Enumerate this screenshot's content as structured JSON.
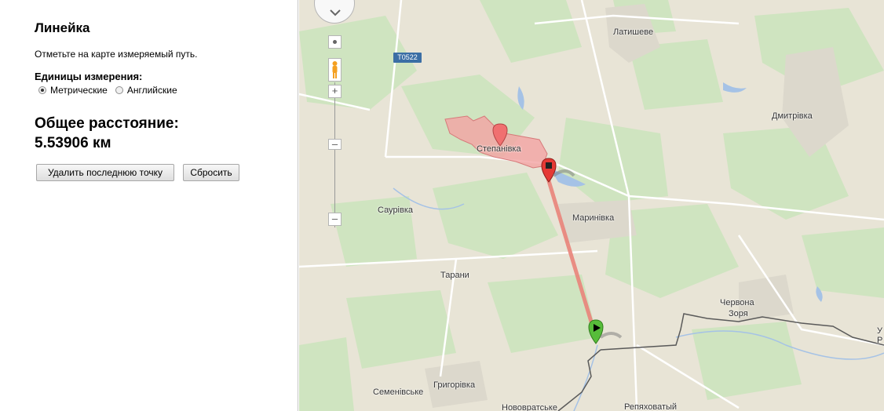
{
  "sidebar": {
    "title": "Линейка",
    "hint": "Отметьте на карте измеряемый путь.",
    "units_label": "Единицы измерения:",
    "units_options": [
      {
        "label": "Метрические",
        "selected": true
      },
      {
        "label": "Английские",
        "selected": false
      }
    ],
    "total_label": "Общее расстояние:",
    "total_value": "5.53906 км",
    "buttons": {
      "undo_label": "Удалить последнюю точку",
      "reset_label": "Сбросить"
    }
  },
  "map": {
    "road_shield": "T0522",
    "places": [
      "Латишеве",
      "Дмитрівка",
      "Степанівка",
      "Саурівка",
      "Маринівка",
      "Тарани",
      "Червона",
      "Зоря",
      "Семенівське",
      "Григорівка",
      "Нововратське",
      "Репяховатый",
      "У",
      "Р"
    ],
    "colors": {
      "route_line": "#e9837a",
      "highlight_area": "#f2a3a3",
      "start_marker": "#57bd3a",
      "end_marker": "#e53935",
      "area_pin": "#f07070"
    },
    "icons": [
      "pan-control-icon",
      "location-icon",
      "pegman-icon",
      "zoom-in-icon",
      "zoom-out-icon",
      "flag-icon",
      "pin-icon"
    ]
  }
}
